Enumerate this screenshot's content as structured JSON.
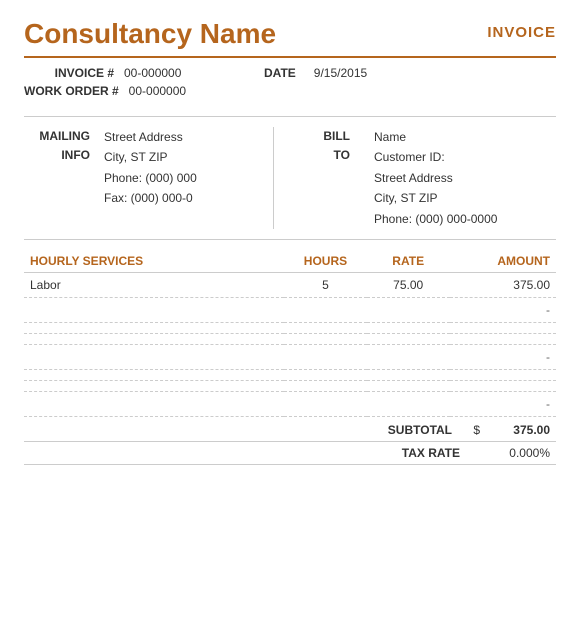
{
  "header": {
    "company_name": "Consultancy Name",
    "invoice_label": "INVOICE"
  },
  "meta": {
    "invoice_label": "INVOICE #",
    "invoice_number": "00-000000",
    "date_label": "DATE",
    "date_value": "9/15/2015",
    "work_order_label": "WORK ORDER #",
    "work_order_number": "00-000000"
  },
  "mailing": {
    "section_label": "MAILING\nINFO",
    "street": "Street Address",
    "city": "City, ST  ZIP",
    "phone": "Phone: (000) 000",
    "fax": "Fax: (000) 000-0"
  },
  "bill_to": {
    "section_label": "BILL\nTO",
    "name": "Name",
    "customer_id": "Customer ID:",
    "street": "Street Address",
    "city": "City, ST  ZIP",
    "phone": "Phone: (000) 000-0000"
  },
  "table": {
    "headers": {
      "service": "HOURLY SERVICES",
      "hours": "HOURS",
      "rate": "RATE",
      "amount": "AMOUNT"
    },
    "rows": [
      {
        "service": "Labor",
        "hours": "5",
        "rate": "75.00",
        "amount": "375.00",
        "show_dash": false
      },
      {
        "service": "",
        "hours": "",
        "rate": "",
        "amount": "",
        "show_dash": true
      },
      {
        "service": "",
        "hours": "",
        "rate": "",
        "amount": "",
        "show_dash": false
      },
      {
        "service": "",
        "hours": "",
        "rate": "",
        "amount": "",
        "show_dash": false
      },
      {
        "service": "",
        "hours": "",
        "rate": "",
        "amount": "",
        "show_dash": true
      },
      {
        "service": "",
        "hours": "",
        "rate": "",
        "amount": "",
        "show_dash": false
      },
      {
        "service": "",
        "hours": "",
        "rate": "",
        "amount": "",
        "show_dash": false
      },
      {
        "service": "",
        "hours": "",
        "rate": "",
        "amount": "",
        "show_dash": true
      }
    ]
  },
  "summary": {
    "subtotal_label": "SUBTOTAL",
    "subtotal_currency": "$",
    "subtotal_value": "375.00",
    "taxrate_label": "TAX RATE",
    "taxrate_value": "0.000%"
  }
}
